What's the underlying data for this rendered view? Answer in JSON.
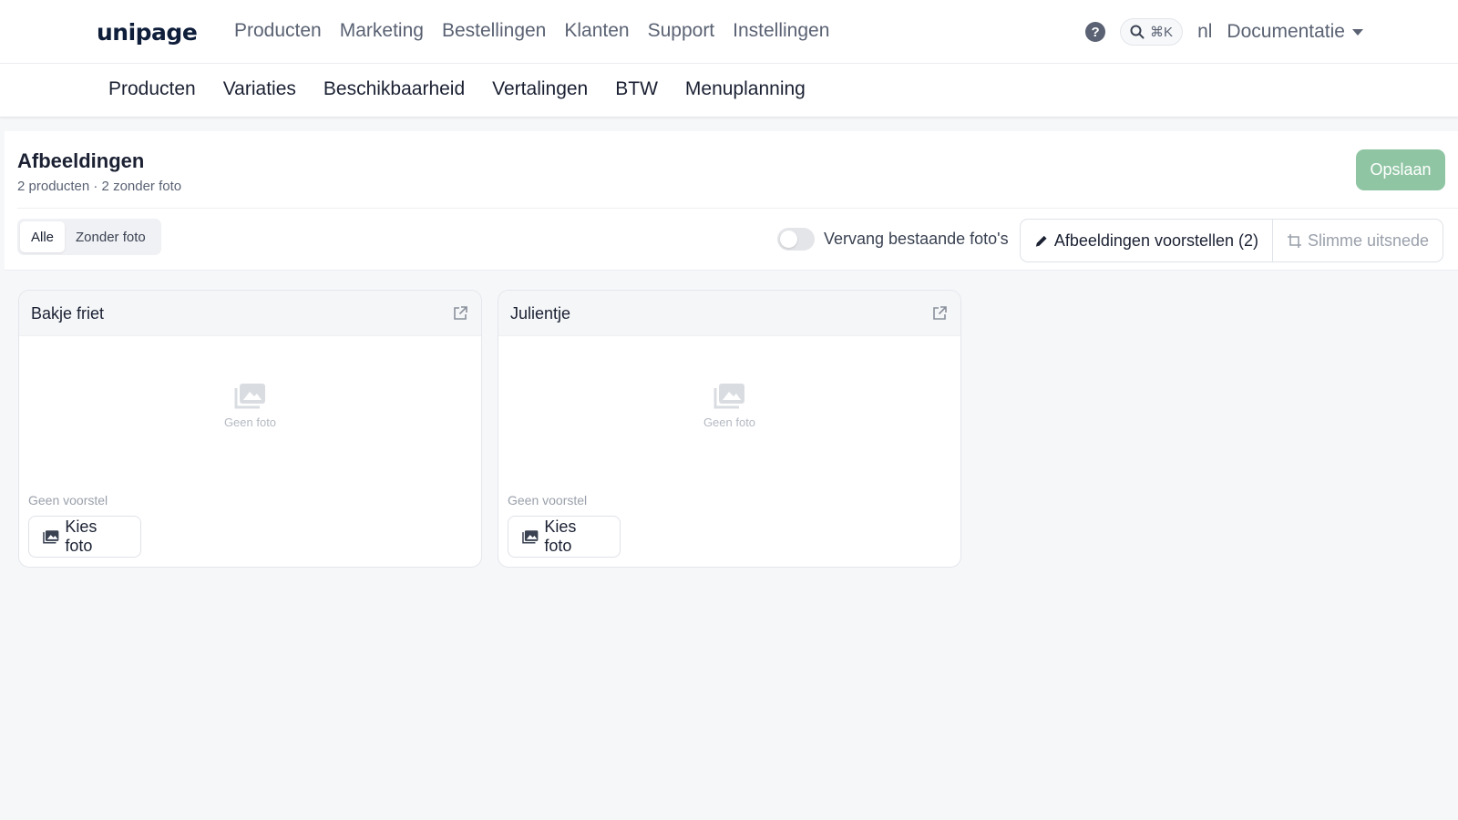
{
  "header": {
    "logo": "unipage",
    "nav": [
      "Producten",
      "Marketing",
      "Bestellingen",
      "Klanten",
      "Support",
      "Instellingen"
    ],
    "search_shortcut": "⌘K",
    "language": "nl",
    "docs_label": "Documentatie"
  },
  "subnav": [
    "Producten",
    "Variaties",
    "Beschikbaarheid",
    "Vertalingen",
    "BTW",
    "Menuplanning"
  ],
  "panel": {
    "title": "Afbeeldingen",
    "subtitle": "2 producten · 2 zonder foto",
    "save_label": "Opslaan",
    "filters": [
      {
        "label": "Alle",
        "active": true
      },
      {
        "label": "Zonder foto",
        "active": false
      }
    ],
    "replace_toggle_label": "Vervang bestaande foto's",
    "replace_toggle_on": false,
    "suggest_label": "Afbeeldingen voorstellen (2)",
    "smart_crop_label": "Slimme uitsnede"
  },
  "products": [
    {
      "name": "Bakje friet",
      "photo_text": "Geen foto",
      "suggestion": "Geen voorstel",
      "choose_label": "Kies foto"
    },
    {
      "name": "Julientje",
      "photo_text": "Geen foto",
      "suggestion": "Geen voorstel",
      "choose_label": "Kies foto"
    }
  ],
  "colors": {
    "save_button": "#8fc5a3",
    "text_dark": "#1b2133",
    "text_muted": "#5a6273",
    "background": "#f6f7f9"
  }
}
